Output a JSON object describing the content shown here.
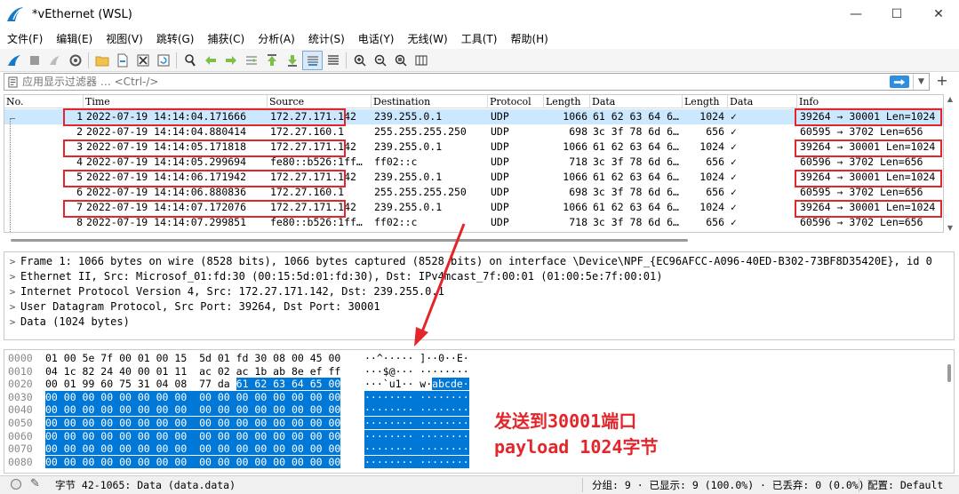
{
  "window": {
    "title": "*vEthernet (WSL)",
    "minimize": "—",
    "maximize": "☐",
    "close": "✕"
  },
  "menu": [
    "文件(F)",
    "编辑(E)",
    "视图(V)",
    "跳转(G)",
    "捕获(C)",
    "分析(A)",
    "统计(S)",
    "电话(Y)",
    "无线(W)",
    "工具(T)",
    "帮助(H)"
  ],
  "filter": {
    "placeholder": "应用显示过滤器 … <Ctrl-/>"
  },
  "packet_list": {
    "columns": [
      "No.",
      "Time",
      "Source",
      "Destination",
      "Protocol",
      "Length",
      "Data",
      "Length",
      "Data",
      "Info"
    ],
    "rows": [
      {
        "no": "1",
        "time": "2022-07-19 14:14:04.171666",
        "src": "172.27.171.142",
        "dst": "239.255.0.1",
        "proto": "UDP",
        "len": "1066",
        "data": "61 62 63 64 6…",
        "len2": "1024",
        "check": "✓",
        "info": "39264 → 30001 Len=1024"
      },
      {
        "no": "2",
        "time": "2022-07-19 14:14:04.880414",
        "src": "172.27.160.1",
        "dst": "255.255.255.250",
        "proto": "UDP",
        "len": "698",
        "data": "3c 3f 78 6d 6…",
        "len2": "656",
        "check": "✓",
        "info": "60595 → 3702 Len=656"
      },
      {
        "no": "3",
        "time": "2022-07-19 14:14:05.171818",
        "src": "172.27.171.142",
        "dst": "239.255.0.1",
        "proto": "UDP",
        "len": "1066",
        "data": "61 62 63 64 6…",
        "len2": "1024",
        "check": "✓",
        "info": "39264 → 30001 Len=1024"
      },
      {
        "no": "4",
        "time": "2022-07-19 14:14:05.299694",
        "src": "fe80::b526:1ff…",
        "dst": "ff02::c",
        "proto": "UDP",
        "len": "718",
        "data": "3c 3f 78 6d 6…",
        "len2": "656",
        "check": "✓",
        "info": "60596 → 3702 Len=656"
      },
      {
        "no": "5",
        "time": "2022-07-19 14:14:06.171942",
        "src": "172.27.171.142",
        "dst": "239.255.0.1",
        "proto": "UDP",
        "len": "1066",
        "data": "61 62 63 64 6…",
        "len2": "1024",
        "check": "✓",
        "info": "39264 → 30001 Len=1024"
      },
      {
        "no": "6",
        "time": "2022-07-19 14:14:06.880836",
        "src": "172.27.160.1",
        "dst": "255.255.255.250",
        "proto": "UDP",
        "len": "698",
        "data": "3c 3f 78 6d 6…",
        "len2": "656",
        "check": "✓",
        "info": "60595 → 3702 Len=656"
      },
      {
        "no": "7",
        "time": "2022-07-19 14:14:07.172076",
        "src": "172.27.171.142",
        "dst": "239.255.0.1",
        "proto": "UDP",
        "len": "1066",
        "data": "61 62 63 64 6…",
        "len2": "1024",
        "check": "✓",
        "info": "39264 → 30001 Len=1024"
      },
      {
        "no": "8",
        "time": "2022-07-19 14:14:07.299851",
        "src": "fe80::b526:1ff…",
        "dst": "ff02::c",
        "proto": "UDP",
        "len": "718",
        "data": "3c 3f 78 6d 6…",
        "len2": "656",
        "check": "✓",
        "info": "60596 → 3702 Len=656"
      }
    ]
  },
  "details": [
    "Frame 1: 1066 bytes on wire (8528 bits), 1066 bytes captured (8528 bits) on interface \\Device\\NPF_{EC96AFCC-A096-40ED-B302-73BF8D35420E}, id 0",
    "Ethernet II, Src: Microsof_01:fd:30 (00:15:5d:01:fd:30), Dst: IPv4mcast_7f:00:01 (01:00:5e:7f:00:01)",
    "Internet Protocol Version 4, Src: 172.27.171.142, Dst: 239.255.0.1",
    "User Datagram Protocol, Src Port: 39264, Dst Port: 30001",
    "Data (1024 bytes)"
  ],
  "bytes": [
    {
      "off": "0000",
      "hex": "01 00 5e 7f 00 01 00 15  5d 01 fd 30 08 00 45 00",
      "hl": "",
      "asc": "··^····· ]··0··E·",
      "ahl": ""
    },
    {
      "off": "0010",
      "hex": "04 1c 82 24 40 00 01 11  ac 02 ac 1b ab 8e ef ff",
      "hl": "",
      "asc": "···$@··· ········",
      "ahl": ""
    },
    {
      "off": "0020",
      "hex": "00 01 99 60 75 31 04 08  77 da ",
      "hl": "61 62 63 64 65 00",
      "asc": "···`u1·· w·",
      "ahl": "abcde·"
    },
    {
      "off": "0030",
      "hex": "",
      "hl": "00 00 00 00 00 00 00 00  00 00 00 00 00 00 00 00",
      "asc": "",
      "ahl": "········ ········"
    },
    {
      "off": "0040",
      "hex": "",
      "hl": "00 00 00 00 00 00 00 00  00 00 00 00 00 00 00 00",
      "asc": "",
      "ahl": "········ ········"
    },
    {
      "off": "0050",
      "hex": "",
      "hl": "00 00 00 00 00 00 00 00  00 00 00 00 00 00 00 00",
      "asc": "",
      "ahl": "········ ········"
    },
    {
      "off": "0060",
      "hex": "",
      "hl": "00 00 00 00 00 00 00 00  00 00 00 00 00 00 00 00",
      "asc": "",
      "ahl": "········ ········"
    },
    {
      "off": "0070",
      "hex": "",
      "hl": "00 00 00 00 00 00 00 00  00 00 00 00 00 00 00 00",
      "asc": "",
      "ahl": "········ ········"
    },
    {
      "off": "0080",
      "hex": "",
      "hl": "00 00 00 00 00 00 00 00  00 00 00 00 00 00 00 00",
      "asc": "",
      "ahl": "········ ········"
    }
  ],
  "annotation": {
    "line1": "发送到30001端口",
    "line2": "payload 1024字节"
  },
  "status": {
    "field": "字节 42-1065: Data (data.data)",
    "packets": "分组: 9 · 已显示: 9 (100.0%) · 已丢弃: 0 (0.0%)",
    "profile": "配置: Default"
  },
  "colors": {
    "selection": "#cce8ff",
    "highlight": "#0078d7",
    "annotation": "#e3262b",
    "accent": "#2f8ee0"
  }
}
